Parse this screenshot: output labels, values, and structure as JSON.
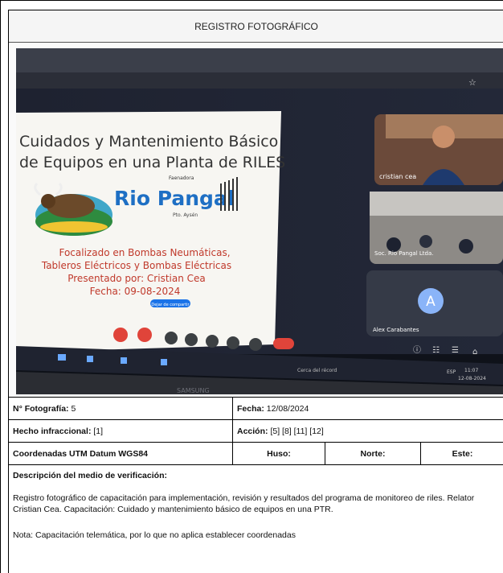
{
  "header": {
    "title": "REGISTRO FOTOGRÁFICO"
  },
  "slide": {
    "title_line1": "Cuidados y Mantenimiento Básico",
    "title_line2": "de Equipos en una Planta de RILES",
    "logo_small": "Faenadora",
    "logo_brand": "Rio Pangal",
    "logo_sub": "Pto. Aysén",
    "focus1": "Focalizado en Bombas Neumáticas,",
    "focus2": "Tableros Eléctricos y Bombas Eléctricas",
    "presenter": "Presentado por: Cristian Cea",
    "date": "Fecha: 09-08-2024",
    "stop_share_label": "Dejar de compartir"
  },
  "participants": [
    {
      "name": "cristian cea"
    },
    {
      "name": "Soc. Rio Pangal Ltda."
    },
    {
      "name": "Alex Carabantes",
      "initial": "A"
    }
  ],
  "taskbar": {
    "search_text": "Cerca del récord",
    "time": "11:07",
    "date": "12-08-2024",
    "lang": "ESP"
  },
  "monitor_brand": "SAMSUNG",
  "fields": {
    "foto_label": "N° Fotografía:",
    "foto_value": "5",
    "fecha_label": "Fecha:",
    "fecha_value": "12/08/2024",
    "hecho_label": "Hecho infraccional:",
    "hecho_value": "[1]",
    "accion_label": "Acción:",
    "accion_value": "[5] [8] [11] [12]",
    "coord_label": "Coordenadas UTM Datum WGS84",
    "huso_label": "Huso:",
    "norte_label": "Norte:",
    "este_label": "Este:"
  },
  "description": {
    "title": "Descripción del medio de verificación:",
    "paragraph": "Registro fotográfico de capacitación para implementación, revisión y resultados del programa de monitoreo de riles. Relator Cristian Cea. Capacitación: Cuidado y mantenimiento básico de equipos en una PTR.",
    "note": "Nota: Capacitación telemática, por lo que no aplica establecer coordenadas"
  },
  "colors": {
    "brand_blue": "#1e6fc4",
    "slide_red": "#c0392b",
    "meet_red": "#e0443a",
    "screen_dark": "#151a24"
  }
}
